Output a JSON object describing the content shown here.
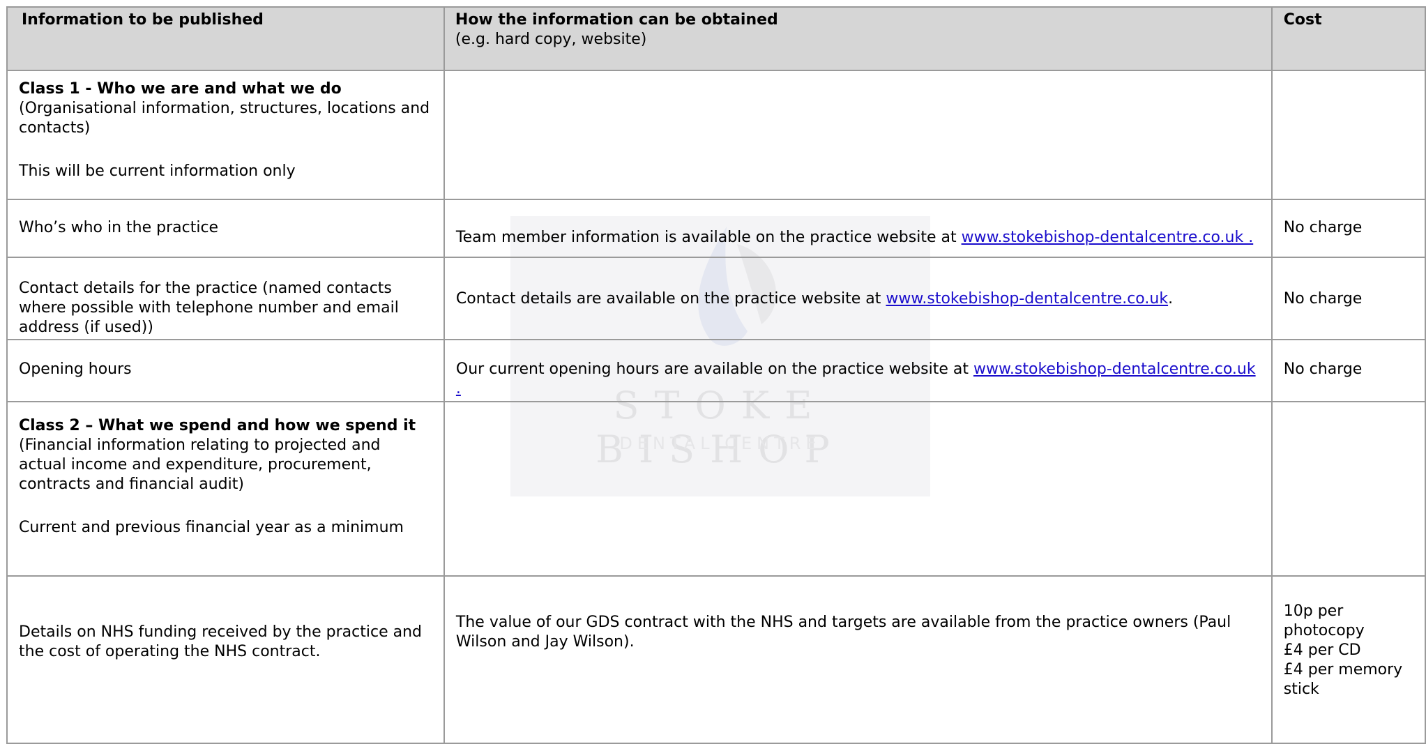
{
  "table": {
    "headers": {
      "col1": "Information to be published",
      "col2_title": "How the information can be obtained",
      "col2_sub": "(e.g. hard copy, website)",
      "col3": "Cost"
    },
    "class1": {
      "title": "Class 1 - Who we are and what we do",
      "desc": "(Organisational information, structures, locations and contacts)",
      "note": "This will be current information only"
    },
    "row_whos_who": {
      "info": "Who’s who in the practice",
      "how_prefix": "Team member information is available on the practice website at ",
      "link": "www.stokebishop-dentalcentre.co.uk .",
      "cost": "No charge"
    },
    "row_contact": {
      "info": "Contact details for the practice (named contacts where possible with telephone number and email address (if used))",
      "how_prefix": "Contact details are available on the practice website at ",
      "link": "www.stokebishop-dentalcentre.co.uk",
      "how_suffix": ".",
      "cost": "No charge"
    },
    "row_hours": {
      "info": "Opening hours",
      "how_prefix": " Our current opening hours are available on the practice website at ",
      "link": "www.stokebishop-dentalcentre.co.uk .",
      "cost": "No charge"
    },
    "class2": {
      "title": "Class 2 – What we spend and how we spend it",
      "desc": "(Financial information relating to projected and actual income and expenditure, procurement, contracts and financial audit)",
      "note": "Current and previous financial year as a minimum"
    },
    "row_nhs": {
      "info": "Details on NHS funding received by the practice and the cost of operating the NHS contract.",
      "how": "The value of our GDS contract with the NHS and targets are available from the practice owners (Paul Wilson and Jay Wilson).",
      "cost_lines": [
        "10p per photocopy",
        "£4 per CD",
        "£4 per memory stick"
      ]
    }
  },
  "watermark": {
    "name": "STOKE BISHOP",
    "sub": "DENTAL CENTRE"
  }
}
